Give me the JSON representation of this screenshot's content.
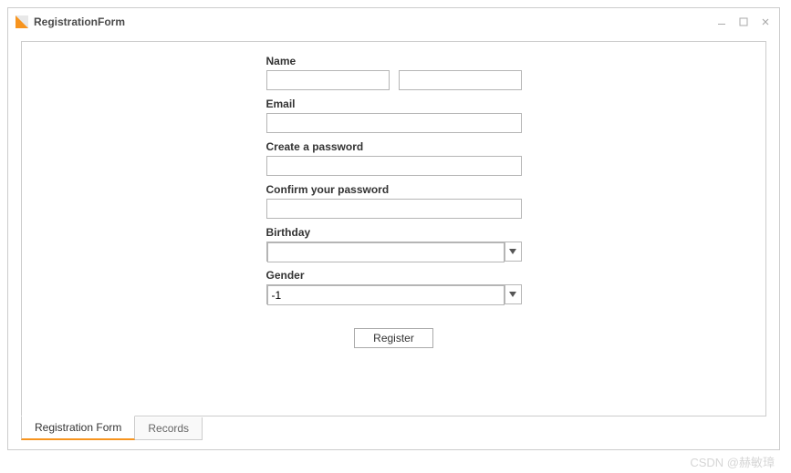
{
  "window": {
    "title": "RegistrationForm"
  },
  "form": {
    "name_label": "Name",
    "first_name": "",
    "last_name": "",
    "email_label": "Email",
    "email": "",
    "create_pw_label": "Create a password",
    "create_pw": "",
    "confirm_pw_label": "Confirm your password",
    "confirm_pw": "",
    "birthday_label": "Birthday",
    "birthday": "",
    "gender_label": "Gender",
    "gender": "-1",
    "register_label": "Register"
  },
  "tabs": {
    "registration": "Registration Form",
    "records": "Records"
  },
  "watermark": "CSDN @赫敏璋"
}
